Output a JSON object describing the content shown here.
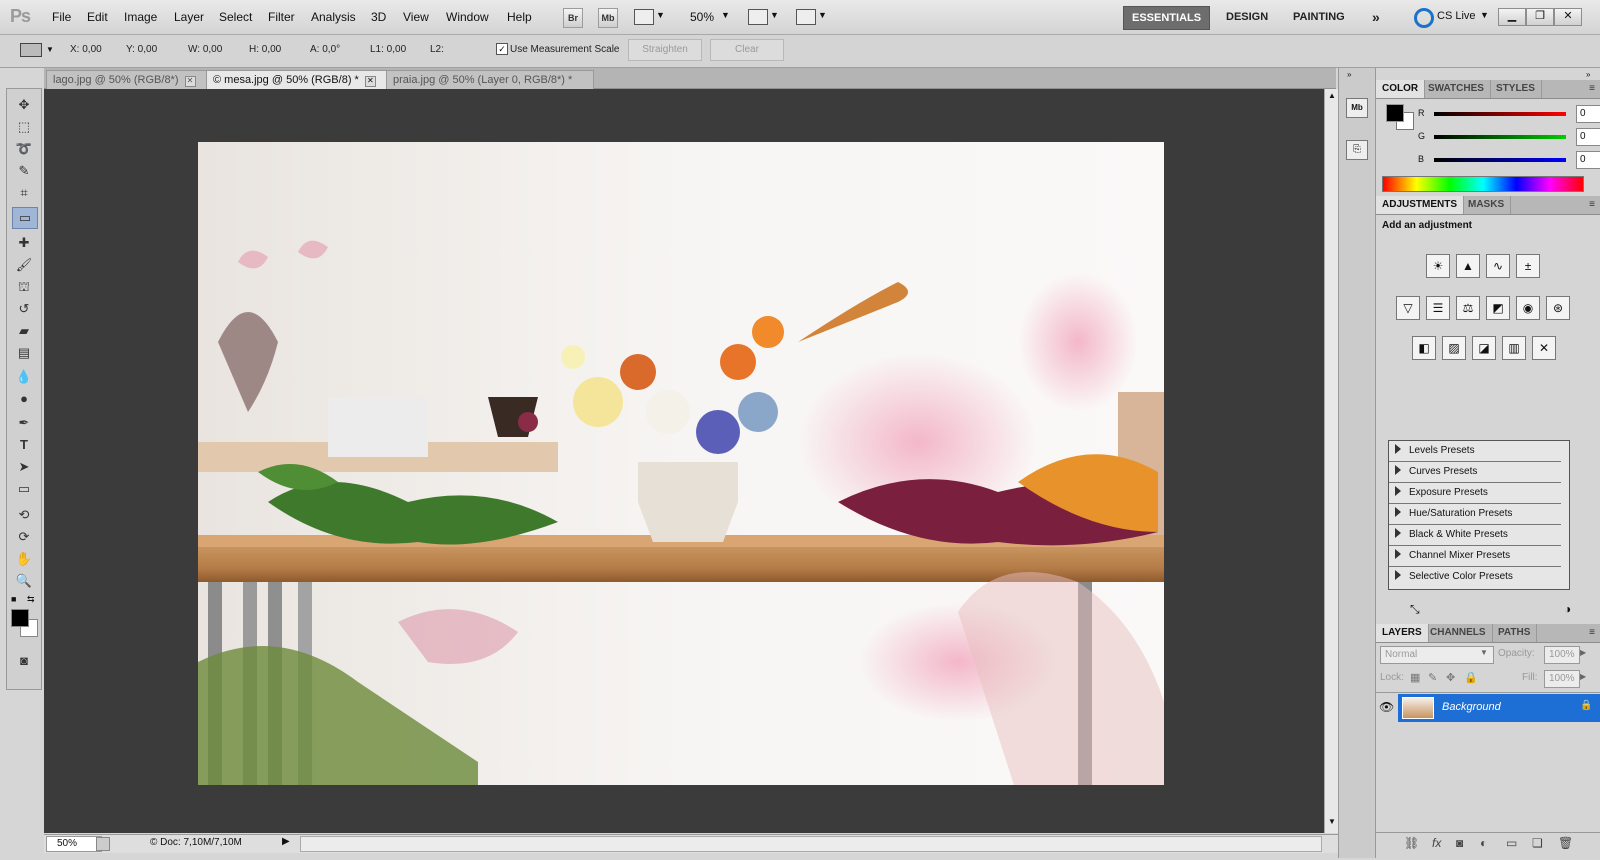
{
  "app": {
    "logo": "Ps"
  },
  "menu": [
    "File",
    "Edit",
    "Image",
    "Layer",
    "Select",
    "Filter",
    "Analysis",
    "3D",
    "View",
    "Window",
    "Help"
  ],
  "menubar_buttons": {
    "bridge": "Br",
    "minibridge": "Mb",
    "zoom": "50%"
  },
  "workspaces": [
    "ESSENTIALS",
    "DESIGN",
    "PAINTING"
  ],
  "workspace_more": "»",
  "cs_live": "CS Live",
  "options": {
    "x": "X: 0,00",
    "y": "Y: 0,00",
    "w": "W: 0,00",
    "h": "H: 0,00",
    "a": "A: 0,0°",
    "l1": "L1: 0,00",
    "l2": "L2:",
    "measurement_scale": "Use Measurement Scale",
    "straighten": "Straighten",
    "clear": "Clear"
  },
  "tabs": [
    {
      "label": "lago.jpg @ 50% (RGB/8*)"
    },
    {
      "label": "© mesa.jpg @ 50% (RGB/8) *"
    },
    {
      "label": "praia.jpg @ 50% (Layer 0, RGB/8*) *"
    }
  ],
  "status": {
    "zoom": "50%",
    "doc": "© Doc: 7,10M/7,10M"
  },
  "color_panel": {
    "tabs": [
      "COLOR",
      "SWATCHES",
      "STYLES"
    ],
    "r_label": "R",
    "g_label": "G",
    "b_label": "B",
    "r": "0",
    "g": "0",
    "b": "0"
  },
  "adjustments_panel": {
    "tabs": [
      "ADJUSTMENTS",
      "MASKS"
    ],
    "title": "Add an adjustment",
    "presets": [
      "Levels Presets",
      "Curves Presets",
      "Exposure Presets",
      "Hue/Saturation Presets",
      "Black & White Presets",
      "Channel Mixer Presets",
      "Selective Color Presets"
    ]
  },
  "layers_panel": {
    "tabs": [
      "LAYERS",
      "CHANNELS",
      "PATHS"
    ],
    "blend_mode": "Normal",
    "opacity_label": "Opacity:",
    "opacity": "100%",
    "lock_label": "Lock:",
    "fill_label": "Fill:",
    "fill": "100%",
    "layer_name": "Background"
  },
  "icons": {
    "menubar": [
      "bridge-icon",
      "minibridge-icon",
      "view-extras-icon",
      "zoom-icon",
      "arrange-documents-icon",
      "screen-mode-icon"
    ],
    "layer": [
      "visibility-eye-icon",
      "lock-icon"
    ]
  },
  "colors": {
    "accent": "#1d6fd6",
    "canvas_bg": "#3b3b3b",
    "panel_bg": "#d5d5d5"
  }
}
